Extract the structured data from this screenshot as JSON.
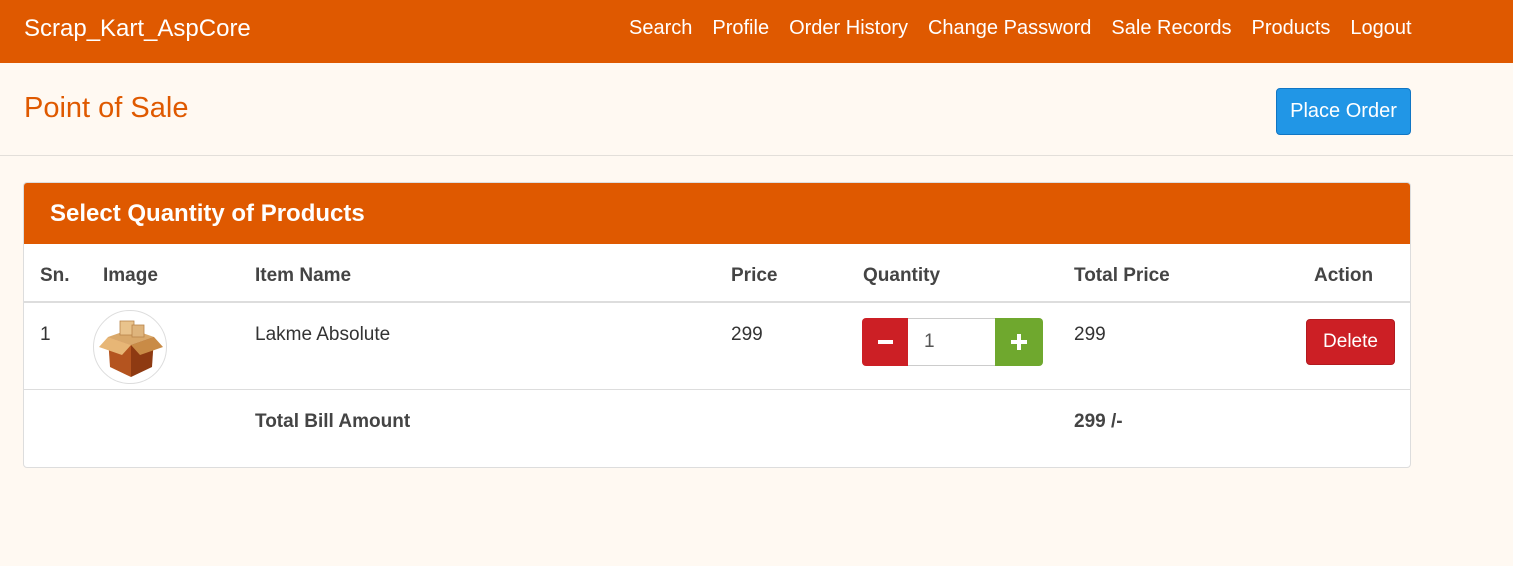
{
  "navbar": {
    "brand": "Scrap_Kart_AspCore",
    "links": [
      "Search",
      "Profile",
      "Order History",
      "Change Password",
      "Sale Records",
      "Products",
      "Logout"
    ]
  },
  "page": {
    "title": "Point of Sale",
    "place_order_label": "Place Order"
  },
  "panel": {
    "heading": "Select Quantity of Products",
    "columns": [
      "Sn.",
      "Image",
      "Item Name",
      "Price",
      "Quantity",
      "Total Price",
      "Action"
    ],
    "rows": [
      {
        "sn": "1",
        "image_icon": "cardboard-box-icon",
        "item_name": "Lakme Absolute",
        "price": "299",
        "quantity": "1",
        "total_price": "299",
        "action_label": "Delete"
      }
    ],
    "total_label": "Total Bill Amount",
    "total_value": "299 /-"
  },
  "colors": {
    "brand": "#df5900",
    "primary_button": "#2196e6",
    "danger": "#cc1f25",
    "success": "#6fa82e",
    "background": "#fff9f2"
  }
}
